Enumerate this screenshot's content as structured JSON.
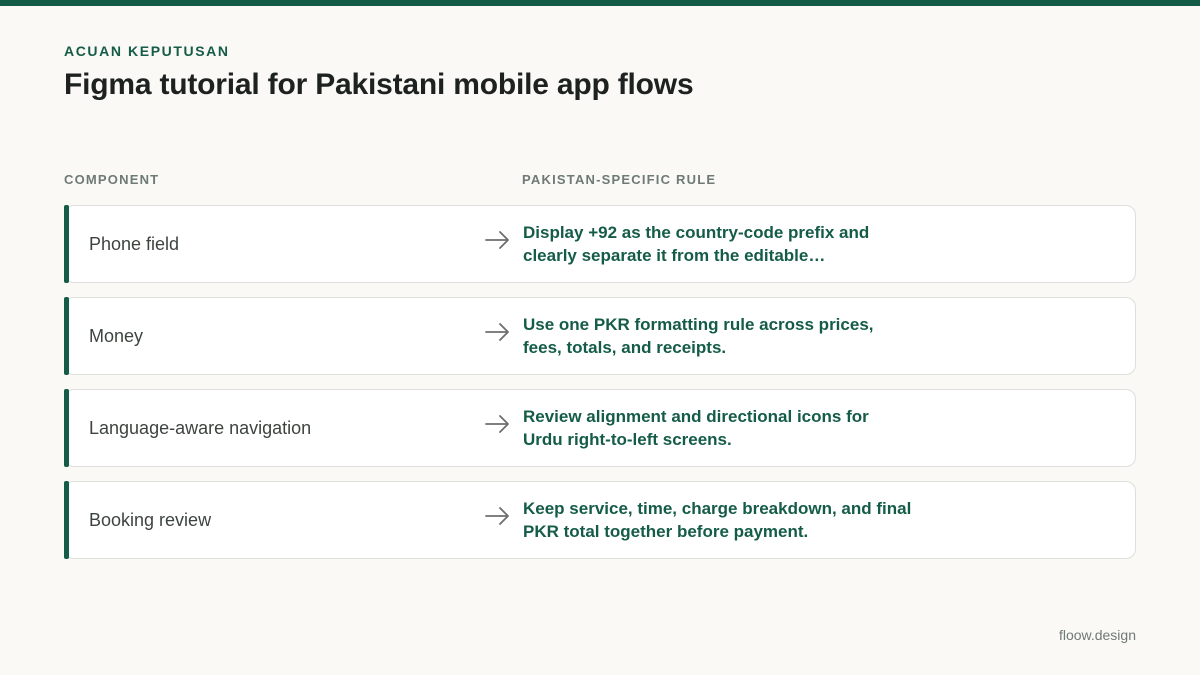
{
  "header": {
    "eyebrow": "ACUAN KEPUTUSAN",
    "title": "Figma tutorial for Pakistani mobile app flows"
  },
  "columns": {
    "component": "COMPONENT",
    "rule": "PAKISTAN-SPECIFIC RULE"
  },
  "rows": [
    {
      "component": "Phone field",
      "rule": "Display +92 as the country-code prefix and clearly separate it from the editable…"
    },
    {
      "component": "Money",
      "rule": "Use one PKR formatting rule across prices, fees, totals, and receipts."
    },
    {
      "component": "Language-aware navigation",
      "rule": "Review alignment and directional icons for Urdu right-to-left screens."
    },
    {
      "component": "Booking review",
      "rule": "Keep service, time, charge breakdown, and final PKR total together before payment."
    }
  ],
  "footer": {
    "brand": "floow.design"
  },
  "colors": {
    "accent": "#155c48",
    "background": "#faf9f5",
    "muted": "#6e7a74"
  },
  "icons": {
    "row_arrow": "arrow-right-icon"
  }
}
